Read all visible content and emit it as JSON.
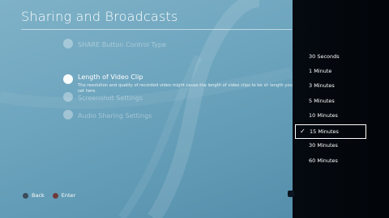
{
  "header": {
    "title": "Sharing and Broadcasts"
  },
  "menu": {
    "items": [
      {
        "label": "SHARE Button Control Type",
        "state": "dim",
        "icon": "wrench-icon"
      },
      {
        "label": "Length of Video Clip",
        "state": "active",
        "icon": "wrench-icon",
        "description": "The resolution and quality of recorded video might cause the length of video clips to be sh length you set here."
      },
      {
        "label": "Screenshot Settings",
        "state": "dim",
        "icon": "wrench-icon"
      },
      {
        "label": "Audio Sharing Settings",
        "state": "dim",
        "icon": "wrench-icon"
      }
    ]
  },
  "options": {
    "items": [
      "30 Seconds",
      "1 Minute",
      "3 Minutes",
      "5 Minutes",
      "10 Minutes",
      "15 Minutes",
      "30 Minutes",
      "60 Minutes"
    ],
    "selected_index": 5,
    "check_icon": "✓"
  },
  "footer": {
    "back_label": "Back",
    "enter_label": "Enter"
  },
  "colors": {
    "panel_bg": "#02050a",
    "background": "#6fa6bf"
  }
}
